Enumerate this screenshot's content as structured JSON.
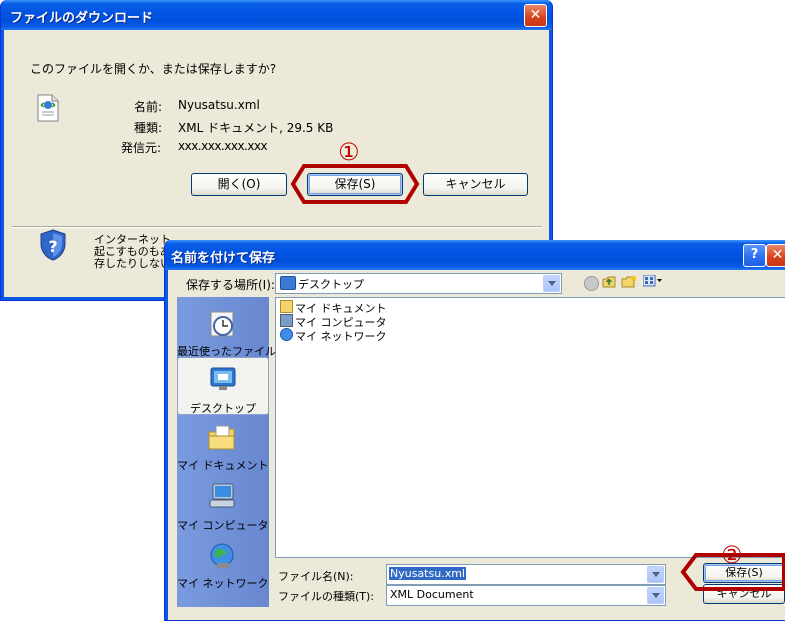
{
  "download_dialog": {
    "title": "ファイルのダウンロード",
    "question": "このファイルを開くか、または保存しますか?",
    "labels": {
      "name": "名前:",
      "type": "種類:",
      "from": "発信元:"
    },
    "values": {
      "name": "Nyusatsu.xml",
      "type": "XML ドキュメント, 29.5 KB",
      "from": "xxx.xxx.xxx.xxx"
    },
    "buttons": {
      "open": "開く(O)",
      "save": "保存(S)",
      "cancel": "キャンセル"
    },
    "warning_lines": [
      "インターネット",
      "起こすものもあ",
      "存したりしない"
    ],
    "step_marker": "①"
  },
  "saveas_dialog": {
    "title": "名前を付けて保存",
    "save_in_label": "保存する場所(I):",
    "save_in_value": "デスクトップ",
    "places": [
      "最近使ったファイル",
      "デスクトップ",
      "マイ ドキュメント",
      "マイ コンピュータ",
      "マイ ネットワーク"
    ],
    "files": [
      "マイ ドキュメント",
      "マイ コンピュータ",
      "マイ ネットワーク"
    ],
    "filename_label": "ファイル名(N):",
    "filename_value": "Nyusatsu.xml",
    "filetype_label": "ファイルの種類(T):",
    "filetype_value": "XML Document",
    "buttons": {
      "save": "保存(S)",
      "cancel": "キャンセル"
    },
    "step_marker": "②"
  },
  "colors": {
    "xp_title": "#0054e3",
    "dialog_bg": "#ece9d8",
    "highlight_red": "#b00000",
    "selection": "#316ac5"
  }
}
